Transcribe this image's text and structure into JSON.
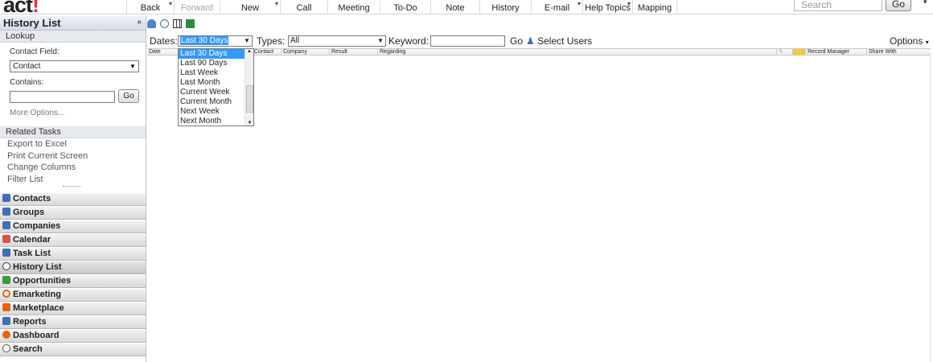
{
  "app": {
    "logo_text": "act",
    "logo_bang": "!"
  },
  "toolbar": {
    "buttons": [
      {
        "label": "Back",
        "disabled": false
      },
      {
        "label": "Forward",
        "disabled": true
      },
      {
        "label": "New",
        "disabled": false
      },
      {
        "label": "Call",
        "disabled": false
      },
      {
        "label": "Meeting",
        "disabled": false
      },
      {
        "label": "To-Do",
        "disabled": false
      },
      {
        "label": "Note",
        "disabled": false
      },
      {
        "label": "History",
        "disabled": false
      },
      {
        "label": "E-mail",
        "disabled": false
      },
      {
        "label": "Help Topics",
        "disabled": false
      },
      {
        "label": "Mapping",
        "disabled": false
      }
    ],
    "search_placeholder": "Search",
    "search_go": "Go"
  },
  "sidebar": {
    "title": "History List",
    "collapse_glyph": "«",
    "lookup": {
      "title": "Lookup",
      "contact_field_label": "Contact Field:",
      "contact_field_value": "Contact",
      "contains_label": "Contains:",
      "contains_value": "",
      "go_label": "Go",
      "more_options": "More Options..."
    },
    "related_tasks": {
      "title": "Related Tasks",
      "items": [
        "Export to Excel",
        "Print Current Screen",
        "Change Columns",
        "Filter List"
      ]
    },
    "nav": [
      {
        "label": "Contacts",
        "color": "#3f6fb5"
      },
      {
        "label": "Groups",
        "color": "#3f6fb5"
      },
      {
        "label": "Companies",
        "color": "#3f6fb5"
      },
      {
        "label": "Calendar",
        "color": "#d9534f"
      },
      {
        "label": "Task List",
        "color": "#3f6fb5"
      },
      {
        "label": "History List",
        "color": "#333333"
      },
      {
        "label": "Opportunities",
        "color": "#3c9b3c"
      },
      {
        "label": "Emarketing",
        "color": "#e8620f"
      },
      {
        "label": "Marketplace",
        "color": "#e8620f"
      },
      {
        "label": "Reports",
        "color": "#3f6fb5"
      },
      {
        "label": "Dashboard",
        "color": "#e8620f"
      },
      {
        "label": "Search",
        "color": "#555555"
      }
    ],
    "active_nav": "History List"
  },
  "filters": {
    "dates_label": "Dates:",
    "dates_value": "Last 30 Days",
    "types_label": "Types:",
    "types_value": "All",
    "keyword_label": "Keyword:",
    "keyword_value": "",
    "go_label": "Go",
    "select_users_label": "Select Users",
    "options_label": "Options"
  },
  "dates_dropdown": {
    "options": [
      "Last 30 Days",
      "Last 90 Days",
      "Last Week",
      "Last Month",
      "Current Week",
      "Current Month",
      "Next Week",
      "Next Month"
    ],
    "selected": "Last 30 Days"
  },
  "grid": {
    "columns": [
      "Date",
      "Contact",
      "Company",
      "Result",
      "Regarding",
      "Record Manager",
      "Share With"
    ],
    "rows": []
  }
}
